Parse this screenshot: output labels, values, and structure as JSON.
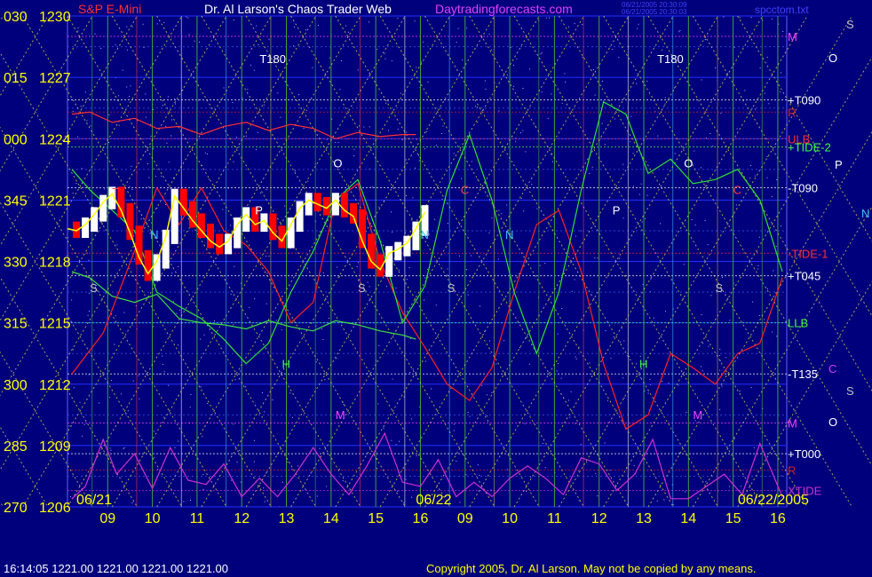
{
  "header": {
    "instrument": "S&P E-Mini",
    "title": "Dr. Al Larson's Chaos Trader Web",
    "site": "Daytradingforecasts.com",
    "stamp1": "06/21/2005 20:30:09",
    "stamp2": "06/21/2005 20:30:03",
    "file": "spcctom.txt"
  },
  "footer": {
    "quote": "16:14:05  1221.00 1221.00 1221.00 1221.00",
    "copyright": "Copyright 2005, Dr. Al Larson. May not be copied by any means."
  },
  "colors": {
    "background": "#00007c",
    "price_up": "#ffffff",
    "price_down": "#ff0000",
    "price_line": "#ffff00",
    "tide1": "#ff2020",
    "tide2": "#20d020",
    "xtide": "#d030d0",
    "grid": "#8080ff"
  },
  "chart_data": {
    "type": "line",
    "ylim": [
      1206,
      1230
    ],
    "y_ticks": [
      {
        "angle": "030",
        "price": "1230",
        "value": 1230
      },
      {
        "angle": "015",
        "price": "1227",
        "value": 1227
      },
      {
        "angle": "000",
        "price": "1224",
        "value": 1224
      },
      {
        "angle": "345",
        "price": "1221",
        "value": 1221
      },
      {
        "angle": "330",
        "price": "1218",
        "value": 1218
      },
      {
        "angle": "315",
        "price": "1215",
        "value": 1215
      },
      {
        "angle": "300",
        "price": "1212",
        "value": 1212
      },
      {
        "angle": "285",
        "price": "1209",
        "value": 1209
      },
      {
        "angle": "270",
        "price": "1206",
        "value": 1206
      }
    ],
    "xlim": [
      0,
      16.1
    ],
    "x_ticks": [
      {
        "label": "09",
        "value": 0.9
      },
      {
        "label": "10",
        "value": 1.9
      },
      {
        "label": "11",
        "value": 2.9
      },
      {
        "label": "12",
        "value": 3.9
      },
      {
        "label": "13",
        "value": 4.9
      },
      {
        "label": "14",
        "value": 5.9
      },
      {
        "label": "15",
        "value": 6.9
      },
      {
        "label": "16",
        "value": 7.9
      },
      {
        "label": "09",
        "value": 8.9
      },
      {
        "label": "10",
        "value": 9.9
      },
      {
        "label": "11",
        "value": 10.9
      },
      {
        "label": "12",
        "value": 11.9
      },
      {
        "label": "13",
        "value": 12.9
      },
      {
        "label": "14",
        "value": 13.9
      },
      {
        "label": "15",
        "value": 14.9
      },
      {
        "label": "16",
        "value": 15.9
      }
    ],
    "date_labels": [
      {
        "label": "06/21",
        "x": 0.2
      },
      {
        "label": "06/22",
        "x": 7.8
      },
      {
        "label": "06/22/2005",
        "x": 15.8
      }
    ],
    "right_labels": [
      {
        "text": "M",
        "y": 1229.0,
        "color": "#ff40ff"
      },
      {
        "text": "+T090",
        "y": 1225.9,
        "color": "#ffffff"
      },
      {
        "text": "R",
        "y": 1225.3,
        "color": "#d02020"
      },
      {
        "text": "ULB",
        "y": 1224.0,
        "color": "#ff3030"
      },
      {
        "text": "+TIDE-2",
        "y": 1223.6,
        "color": "#40ff40"
      },
      {
        "text": "-T090",
        "y": 1221.6,
        "color": "#ffffff"
      },
      {
        "text": "-TIDE-1",
        "y": 1218.4,
        "color": "#ff3030"
      },
      {
        "text": "+T045",
        "y": 1217.3,
        "color": "#ffffff"
      },
      {
        "text": "LLB",
        "y": 1215.0,
        "color": "#40ff40"
      },
      {
        "text": "-T135",
        "y": 1212.5,
        "color": "#ffffff"
      },
      {
        "text": "M",
        "y": 1210.1,
        "color": "#ff40ff"
      },
      {
        "text": "+T000",
        "y": 1208.6,
        "color": "#ffffff"
      },
      {
        "text": "R",
        "y": 1207.8,
        "color": "#d02020"
      },
      {
        "text": "XTIDE",
        "y": 1206.8,
        "color": "#d030d0"
      }
    ],
    "side_letters": [
      {
        "text": "S",
        "color": "#c0c0c0"
      },
      {
        "text": "O",
        "color": "#ffffff"
      },
      {
        "text": "P",
        "color": "#ffffff"
      },
      {
        "text": "N",
        "color": "#40c0ff"
      },
      {
        "text": "C",
        "color": "#d040ff"
      },
      {
        "text": "S",
        "color": "#c0c0c0"
      },
      {
        "text": "O",
        "color": "#ffffff"
      }
    ],
    "markers": [
      {
        "text": "T180",
        "x": 4.3,
        "y": 1227.7,
        "color": "#ffffff"
      },
      {
        "text": "T180",
        "x": 13.2,
        "y": 1227.7,
        "color": "#ffffff"
      },
      {
        "text": "O",
        "x": 5.95,
        "y": 1222.6,
        "color": "#ffffff"
      },
      {
        "text": "O",
        "x": 13.8,
        "y": 1222.6,
        "color": "#ffffff"
      },
      {
        "text": "P",
        "x": 4.2,
        "y": 1220.3,
        "color": "#ffffff"
      },
      {
        "text": "P",
        "x": 12.2,
        "y": 1220.3,
        "color": "#ffffff"
      },
      {
        "text": "N",
        "x": 1.85,
        "y": 1219.1,
        "color": "#40c0ff"
      },
      {
        "text": "N",
        "x": 7.9,
        "y": 1219.1,
        "color": "#40c0ff"
      },
      {
        "text": "N",
        "x": 9.8,
        "y": 1219.1,
        "color": "#40c0ff"
      },
      {
        "text": "S",
        "x": 0.5,
        "y": 1216.5,
        "color": "#c0c0c0"
      },
      {
        "text": "S",
        "x": 6.5,
        "y": 1216.5,
        "color": "#c0c0c0"
      },
      {
        "text": "S",
        "x": 8.5,
        "y": 1216.5,
        "color": "#c0c0c0"
      },
      {
        "text": "S",
        "x": 14.5,
        "y": 1216.5,
        "color": "#c0c0c0"
      },
      {
        "text": "H",
        "x": 4.8,
        "y": 1212.8,
        "color": "#40ff40"
      },
      {
        "text": "H",
        "x": 12.8,
        "y": 1212.8,
        "color": "#40ff40"
      },
      {
        "text": "M",
        "x": 6.0,
        "y": 1210.3,
        "color": "#ff40ff"
      },
      {
        "text": "M",
        "x": 14.0,
        "y": 1210.3,
        "color": "#ff40ff"
      },
      {
        "text": "C",
        "x": 8.8,
        "y": 1221.3,
        "color": "#ff4040"
      },
      {
        "text": "C",
        "x": 14.9,
        "y": 1221.3,
        "color": "#ff4040"
      },
      {
        "text": "T",
        "x": 1.0,
        "y": 1221.2,
        "color": "#ff4040"
      }
    ],
    "series": [
      {
        "name": "ULB",
        "role": "upper line",
        "x": [
          0.1,
          0.5,
          1.0,
          1.5,
          2.0,
          2.5,
          3.0,
          3.5,
          4.0,
          4.5,
          5.0,
          5.5,
          6.0,
          6.5,
          7.0,
          7.5,
          7.8
        ],
        "values": [
          1225.2,
          1225.3,
          1224.8,
          1225.0,
          1224.5,
          1224.6,
          1224.2,
          1224.6,
          1224.8,
          1224.4,
          1224.7,
          1224.5,
          1224.0,
          1224.3,
          1224.1,
          1224.2,
          1224.2
        ]
      },
      {
        "name": "LLB",
        "role": "lower line",
        "x": [
          0.1,
          0.5,
          1.0,
          1.5,
          2.0,
          2.5,
          3.0,
          3.5,
          4.0,
          4.5,
          5.0,
          5.5,
          6.0,
          6.5,
          7.0,
          7.5,
          7.8
        ],
        "values": [
          1217.5,
          1217.2,
          1216.3,
          1216.0,
          1216.4,
          1215.2,
          1215.0,
          1214.9,
          1214.7,
          1215.1,
          1214.8,
          1214.6,
          1215.1,
          1214.9,
          1214.6,
          1214.4,
          1214.2
        ]
      },
      {
        "name": "TIDE-1",
        "x": [
          0.1,
          0.8,
          1.5,
          2.0,
          2.5,
          3.0,
          3.5,
          4.0,
          4.5,
          5.0,
          5.5,
          6.0,
          6.5,
          7.0,
          7.5,
          8.0,
          8.5,
          9.0,
          9.5,
          10.0,
          10.5,
          11.0,
          11.5,
          12.0,
          12.5,
          13.0,
          13.5,
          14.0,
          14.5,
          15.0,
          15.5,
          16.0
        ],
        "values": [
          1212.5,
          1214.5,
          1218.5,
          1221.6,
          1219.8,
          1221.6,
          1219.5,
          1218.8,
          1217.5,
          1215.0,
          1216.0,
          1221.0,
          1221.8,
          1218.0,
          1215.5,
          1213.8,
          1212.0,
          1211.2,
          1212.8,
          1216.5,
          1219.8,
          1220.5,
          1217.5,
          1213.0,
          1209.8,
          1210.5,
          1213.5,
          1212.8,
          1212.0,
          1213.5,
          1214.0,
          1217.2
        ]
      },
      {
        "name": "TIDE-2",
        "x": [
          0.1,
          0.5,
          1.0,
          1.5,
          2.0,
          2.5,
          3.0,
          3.5,
          4.0,
          4.5,
          5.0,
          5.5,
          6.0,
          6.5,
          7.0,
          7.5,
          8.0,
          8.5,
          9.0,
          9.5,
          10.0,
          10.5,
          11.0,
          11.5,
          12.0,
          12.5,
          13.0,
          13.5,
          14.0,
          14.5,
          15.0,
          15.5,
          16.0
        ],
        "values": [
          1222.5,
          1221.5,
          1220.5,
          1219.5,
          1216.5,
          1215.8,
          1215.2,
          1214.2,
          1213.0,
          1214.0,
          1216.5,
          1218.5,
          1221.0,
          1222.0,
          1219.0,
          1215.0,
          1216.8,
          1221.5,
          1224.2,
          1221.0,
          1216.5,
          1213.5,
          1216.5,
          1221.5,
          1225.8,
          1225.2,
          1222.3,
          1223.0,
          1221.8,
          1222.0,
          1222.5,
          1221.0,
          1217.5
        ]
      },
      {
        "name": "XTIDE",
        "x": [
          0.1,
          0.4,
          0.8,
          1.1,
          1.5,
          1.9,
          2.3,
          2.7,
          3.1,
          3.5,
          3.9,
          4.3,
          4.7,
          5.1,
          5.5,
          5.9,
          6.3,
          6.7,
          7.1,
          7.5,
          7.9,
          8.3,
          8.7,
          9.1,
          9.5,
          9.9,
          10.3,
          10.7,
          11.1,
          11.5,
          11.9,
          12.3,
          12.7,
          13.1,
          13.5,
          13.9,
          14.3,
          14.7,
          15.1,
          15.5,
          16.0
        ],
        "values": [
          1206.4,
          1207.0,
          1209.3,
          1207.6,
          1208.6,
          1206.9,
          1208.9,
          1207.3,
          1207.1,
          1208.1,
          1206.5,
          1207.4,
          1206.5,
          1207.6,
          1208.9,
          1207.6,
          1206.6,
          1208.0,
          1209.6,
          1207.2,
          1207.0,
          1208.3,
          1206.5,
          1207.2,
          1206.5,
          1207.4,
          1208.0,
          1207.4,
          1206.6,
          1208.4,
          1208.1,
          1206.8,
          1207.6,
          1209.3,
          1206.4,
          1206.4,
          1207.0,
          1207.6,
          1206.6,
          1209.1,
          1206.5
        ]
      },
      {
        "name": "Price",
        "x": [
          0.0,
          0.2,
          0.4,
          0.6,
          0.8,
          1.0,
          1.2,
          1.4,
          1.6,
          1.8,
          2.0,
          2.2,
          2.4,
          2.6,
          2.8,
          3.0,
          3.2,
          3.4,
          3.6,
          3.8,
          4.0,
          4.2,
          4.4,
          4.6,
          4.8,
          5.0,
          5.2,
          5.4,
          5.6,
          5.8,
          6.0,
          6.2,
          6.4,
          6.6,
          6.8,
          7.0,
          7.2,
          7.4,
          7.6,
          7.8,
          8.0
        ],
        "values": [
          1219.6,
          1219.5,
          1219.8,
          1220.3,
          1220.9,
          1221.3,
          1220.5,
          1219.4,
          1218.2,
          1217.4,
          1218.0,
          1219.2,
          1221.2,
          1220.6,
          1220.0,
          1219.5,
          1219.0,
          1218.7,
          1219.0,
          1219.8,
          1220.3,
          1219.8,
          1220.0,
          1219.4,
          1219.0,
          1219.8,
          1220.6,
          1221.0,
          1220.8,
          1220.6,
          1221.0,
          1220.5,
          1220.2,
          1219.0,
          1218.0,
          1217.6,
          1218.4,
          1218.6,
          1218.9,
          1219.6,
          1220.4
        ]
      }
    ]
  }
}
